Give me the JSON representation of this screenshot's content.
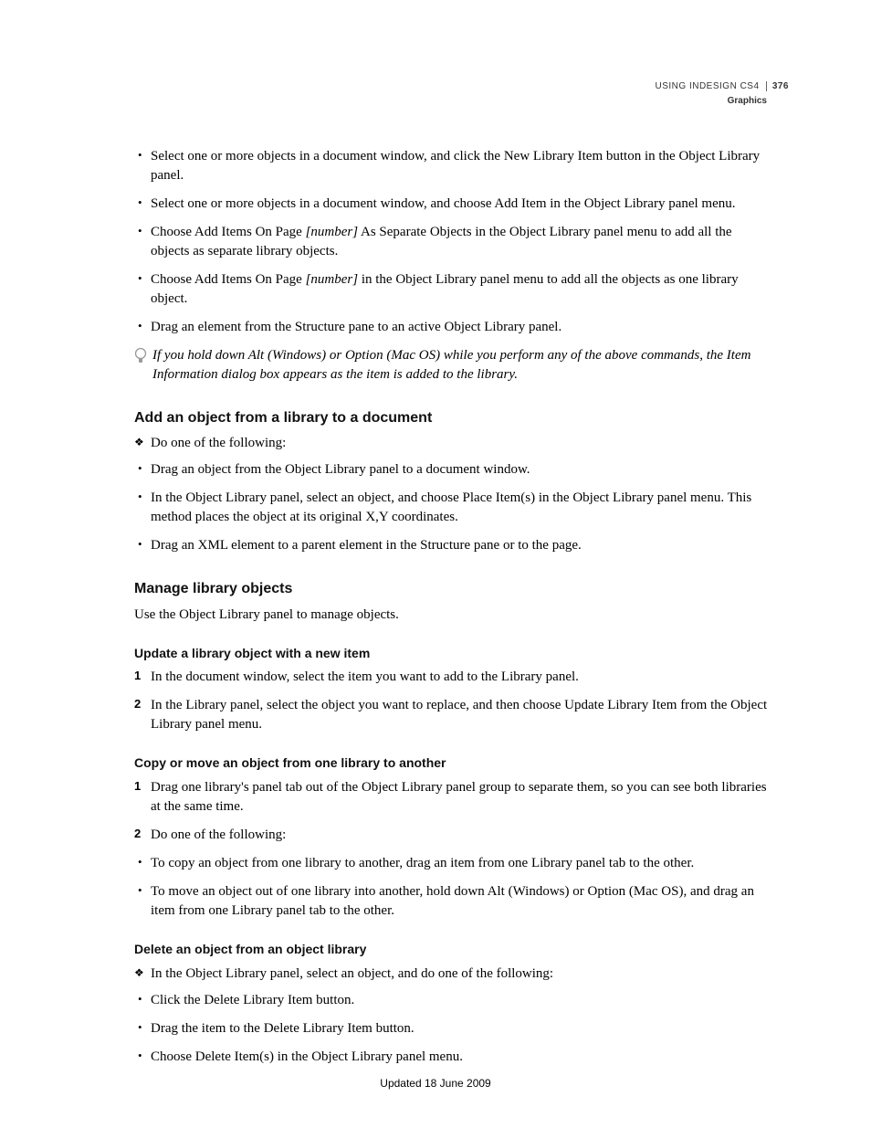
{
  "header": {
    "product": "USING INDESIGN CS4",
    "section": "Graphics",
    "page": "376"
  },
  "section_a": {
    "bul1": "Select one or more objects in a document window, and click the New Library Item button in the Object Library panel.",
    "bul2": "Select one or more objects in a document window, and choose Add Item in the Object Library panel menu.",
    "bul3a": "Choose Add Items On Page ",
    "bul3_em": "[number]",
    "bul3b": " As Separate Objects in the Object Library panel menu to add all the objects as separate library objects.",
    "bul4a": "Choose Add Items On Page ",
    "bul4_em": "[number]",
    "bul4b": " in the Object Library panel menu to add all the objects as one library object.",
    "bul5": "Drag an element from the Structure pane to an active Object Library panel.",
    "tip": "If you hold down Alt (Windows) or Option (Mac OS) while you perform any of the above commands, the Item Information dialog box appears as the item is added to the library."
  },
  "add_obj": {
    "heading": "Add an object from a library to a document",
    "lead": "Do one of the following:",
    "b1": "Drag an object from the Object Library panel to a document window.",
    "b2": "In the Object Library panel, select an object, and choose Place Item(s) in the Object Library panel menu. This method places the object at its original X,Y coordinates.",
    "b3": "Drag an XML element to a parent element in the Structure pane or to the page."
  },
  "manage": {
    "heading": "Manage library objects",
    "intro": "Use the Object Library panel to manage objects."
  },
  "update": {
    "heading": "Update a library object with a new item",
    "s1": "In the document window, select the item you want to add to the Library panel.",
    "s2": "In the Library panel, select the object you want to replace, and then choose Update Library Item from the Object Library panel menu."
  },
  "copymove": {
    "heading": "Copy or move an object from one library to another",
    "s1": "Drag one library's panel tab out of the Object Library panel group to separate them, so you can see both libraries at the same time.",
    "s2": "Do one of the following:",
    "b1": "To copy an object from one library to another, drag an item from one Library panel tab to the other.",
    "b2": "To move an object out of one library into another, hold down Alt (Windows) or Option (Mac OS), and drag an item from one Library panel tab to the other."
  },
  "delete": {
    "heading": "Delete an object from an object library",
    "lead": "In the Object Library panel, select an object, and do one of the following:",
    "b1": "Click the Delete Library Item button.",
    "b2": "Drag the item to the Delete Library Item button.",
    "b3": "Choose Delete Item(s) in the Object Library panel menu."
  },
  "footer": "Updated 18 June 2009"
}
